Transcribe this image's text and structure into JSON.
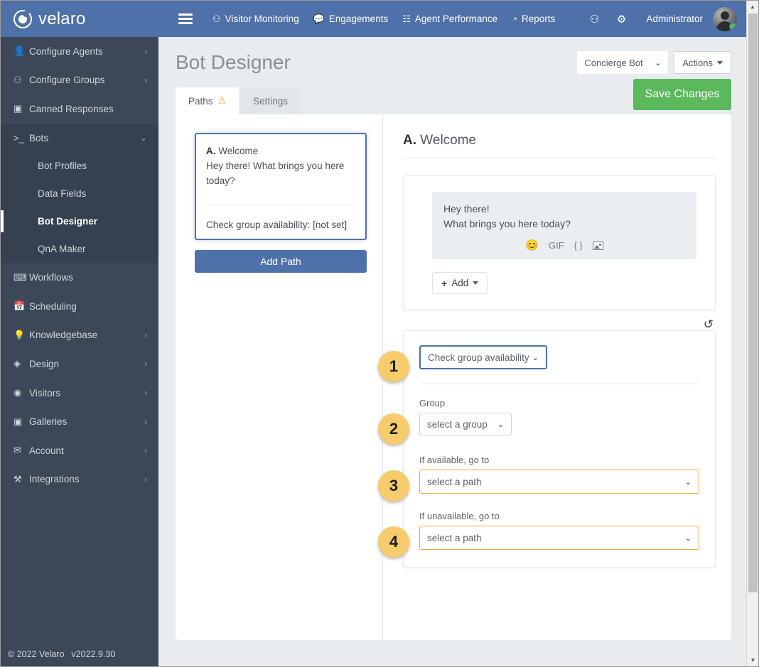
{
  "brand": {
    "name": "velaro",
    "logo_icon": "velaro-logo-icon"
  },
  "navbar": {
    "hamburger_icon": "hamburger-menu-icon",
    "items": [
      {
        "label": "Visitor Monitoring",
        "icon": "users-group-icon",
        "glyph": "⚇"
      },
      {
        "label": "Engagements",
        "icon": "chat-bubble-icon",
        "glyph": "○"
      },
      {
        "label": "Agent Performance",
        "icon": "grid-table-icon",
        "glyph": "☷"
      },
      {
        "label": "Reports",
        "icon": "pie-chart-icon",
        "glyph": "◔"
      }
    ],
    "right_icons": [
      {
        "icon": "users-group-icon",
        "glyph": "⚇"
      },
      {
        "icon": "gear-settings-icon",
        "glyph": "⚙"
      }
    ],
    "user_name": "Administrator",
    "avatar_icon": "user-avatar",
    "status_icon": "online-status-dot"
  },
  "sidebar": {
    "items": [
      {
        "label": "Configure Agents",
        "icon": "person-icon",
        "glyph": "♟",
        "caret": "›",
        "type": "group"
      },
      {
        "label": "Configure Groups",
        "icon": "users-group-icon",
        "glyph": "⚇",
        "caret": "›",
        "type": "group"
      },
      {
        "label": "Canned Responses",
        "icon": "edit-square-icon",
        "glyph": "▣",
        "caret": "",
        "type": "link"
      },
      {
        "label": "Bots",
        "icon": "terminal-prompt-icon",
        "glyph": ">_",
        "caret": "⌄",
        "type": "group-open"
      }
    ],
    "bots_children": [
      {
        "label": "Bot Profiles",
        "active": false
      },
      {
        "label": "Data Fields",
        "active": false
      },
      {
        "label": "Bot Designer",
        "active": true
      },
      {
        "label": "QnA Maker",
        "active": false
      }
    ],
    "items_after": [
      {
        "label": "Workflows",
        "icon": "keyboard-icon",
        "glyph": "⌨",
        "caret": "",
        "type": "link"
      },
      {
        "label": "Scheduling",
        "icon": "calendar-icon",
        "glyph": "Ὄ5",
        "caret": "",
        "type": "link"
      },
      {
        "label": "Knowledgebase",
        "icon": "lightbulb-icon",
        "glyph": "Ὂ1",
        "caret": "›",
        "type": "group"
      },
      {
        "label": "Design",
        "icon": "diamond-gem-icon",
        "glyph": "◈",
        "caret": "›",
        "type": "group"
      },
      {
        "label": "Visitors",
        "icon": "eye-icon",
        "glyph": "◉",
        "caret": "›",
        "type": "group"
      },
      {
        "label": "Galleries",
        "icon": "image-picture-icon",
        "glyph": "▣",
        "caret": "›",
        "type": "group"
      },
      {
        "label": "Account",
        "icon": "envelope-mail-icon",
        "glyph": "✉",
        "caret": "›",
        "type": "group"
      },
      {
        "label": "Integrations",
        "icon": "plug-connector-icon",
        "glyph": "⚒",
        "caret": "›",
        "type": "group"
      }
    ]
  },
  "footer": {
    "copyright": "© 2022 Velaro",
    "version": "v2022.9.30"
  },
  "page": {
    "title": "Bot Designer",
    "bot_selector_value": "Concierge Bot",
    "actions_label": "Actions",
    "save_label": "Save Changes",
    "save_color": "#5cb85c"
  },
  "tabs": [
    {
      "label": "Paths",
      "active": true,
      "warning_icon": "warning-triangle-icon",
      "warning_glyph": "⚠",
      "warning_color": "#f0a030"
    },
    {
      "label": "Settings",
      "active": false,
      "warning_icon": "",
      "warning_glyph": ""
    }
  ],
  "paths_pane": {
    "path_prefix": "A.",
    "path_name": "Welcome",
    "path_message": "Hey there! What brings you here today?",
    "path_action_summary": "Check group availability: [not set]",
    "add_path_label": "Add Path"
  },
  "detail_pane": {
    "heading_prefix": "A.",
    "heading_name": "Welcome",
    "bubble_line1": "Hey there!",
    "bubble_line2": "What brings you here today?",
    "bubble_tools": [
      {
        "icon": "emoji-smiley-icon",
        "label": "😊"
      },
      {
        "icon": "gif-icon",
        "label": "GIF"
      },
      {
        "icon": "code-braces-icon",
        "label": "{ }"
      },
      {
        "icon": "image-insert-icon",
        "label": ""
      }
    ],
    "add_label": "Add",
    "undo_icon": "undo-reset-icon",
    "undo_glyph": "↺"
  },
  "action_form": {
    "callout_color": "#f7cc6c",
    "fields": [
      {
        "callout": "1",
        "label": "",
        "value": "Check group availability",
        "name": "action-type-select",
        "style": "focus-blue"
      },
      {
        "callout": "2",
        "label": "Group",
        "value": "select a group",
        "name": "group-select",
        "style": "w-group"
      },
      {
        "callout": "3",
        "label": "If available, go to",
        "value": "select a path",
        "name": "if-available-path-select",
        "style": "warn"
      },
      {
        "callout": "4",
        "label": "If unavailable, go to",
        "value": "select a path",
        "name": "if-unavailable-path-select",
        "style": "warn"
      }
    ]
  },
  "scrollbar": {
    "up_glyph": "▲",
    "down_glyph": "▼"
  }
}
